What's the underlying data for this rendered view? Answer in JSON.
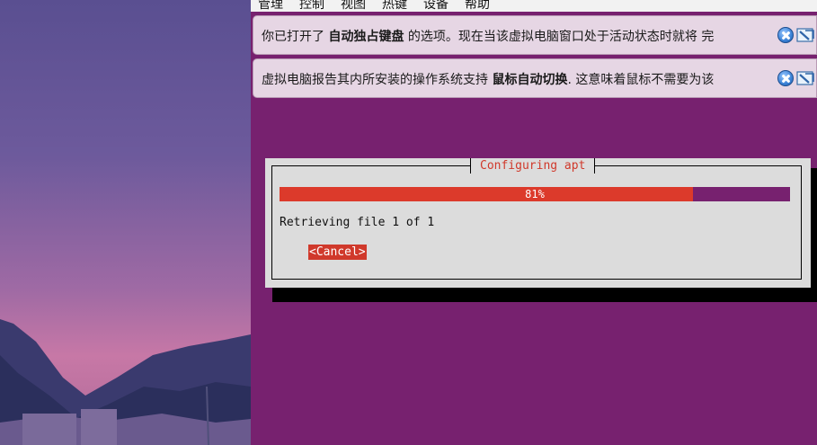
{
  "menubar": {
    "items": [
      "管理",
      "控制",
      "视图",
      "热键",
      "设备",
      "帮助"
    ]
  },
  "notices": [
    {
      "text_before": "你已打开了 ",
      "text_bold": "自动独占键盘",
      "text_after": " 的选项。现在当该虚拟电脑窗口处于活动状态时就将 完"
    },
    {
      "text_before": "虚拟电脑报告其内所安装的操作系统支持 ",
      "text_bold": "鼠标自动切换",
      "text_after": ". 这意味着鼠标不需要为该"
    }
  ],
  "dialog": {
    "title": "Configuring apt",
    "progress_label": "81%",
    "progress_fraction": 0.81,
    "status": "Retrieving file 1 of 1",
    "cancel_label": "<Cancel>"
  },
  "colors": {
    "vm_background": "#77216f",
    "progress_fill": "#dc3a2b",
    "title_text": "#d0392b",
    "cancel_bg": "#d0392b",
    "dialog_bg": "#dcdcdc"
  },
  "icons": {
    "notice_close": "close-circle-icon",
    "notice_mute": "mute-notification-icon"
  }
}
